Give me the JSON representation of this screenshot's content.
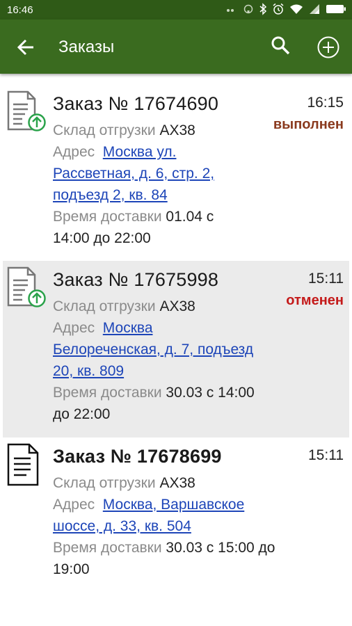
{
  "status_bar": {
    "time": "16:46"
  },
  "app_bar": {
    "title": "Заказы"
  },
  "labels": {
    "warehouse": "Склад отгрузки",
    "address": "Адрес",
    "delivery_time": "Время доставки"
  },
  "colors": {
    "toolbar": "#3a6b1f",
    "status_done": "#8a3a1e",
    "status_cancelled": "#c41a1a",
    "link": "#1d45b8",
    "upload_icon": "#2aa24a"
  },
  "orders": [
    {
      "title": "Заказ № 17674690",
      "time": "16:15",
      "status": "выполнен",
      "warehouse": "АХ38",
      "address_l1": "Москва ул.",
      "address_l2": "Рассветная, д. 6, стр. 2,",
      "address_l3": "подъезд 2, кв. 84",
      "delivery_l1": "01.04 с",
      "delivery_l2": "14:00 до 22:00",
      "icon": "document-upload-icon"
    },
    {
      "title": "Заказ № 17675998",
      "time": "15:11",
      "status": "отменен",
      "warehouse": "АХ38",
      "address_l1": "Москва",
      "address_l2": "Белореченская, д. 7, подъезд",
      "address_l3": "20, кв. 809",
      "delivery_l1": "30.03 с 14:00",
      "delivery_l2": "до 22:00",
      "icon": "document-upload-icon"
    },
    {
      "title": "Заказ № 17678699",
      "time": "15:11",
      "status": "",
      "warehouse": "АХ38",
      "address_l1": "Москва, Варшавское",
      "address_l2": "шоссе, д. 33, кв. 504",
      "delivery_l1": "30.03 с 15:00 до",
      "delivery_l2": "19:00",
      "icon": "document-icon"
    }
  ]
}
